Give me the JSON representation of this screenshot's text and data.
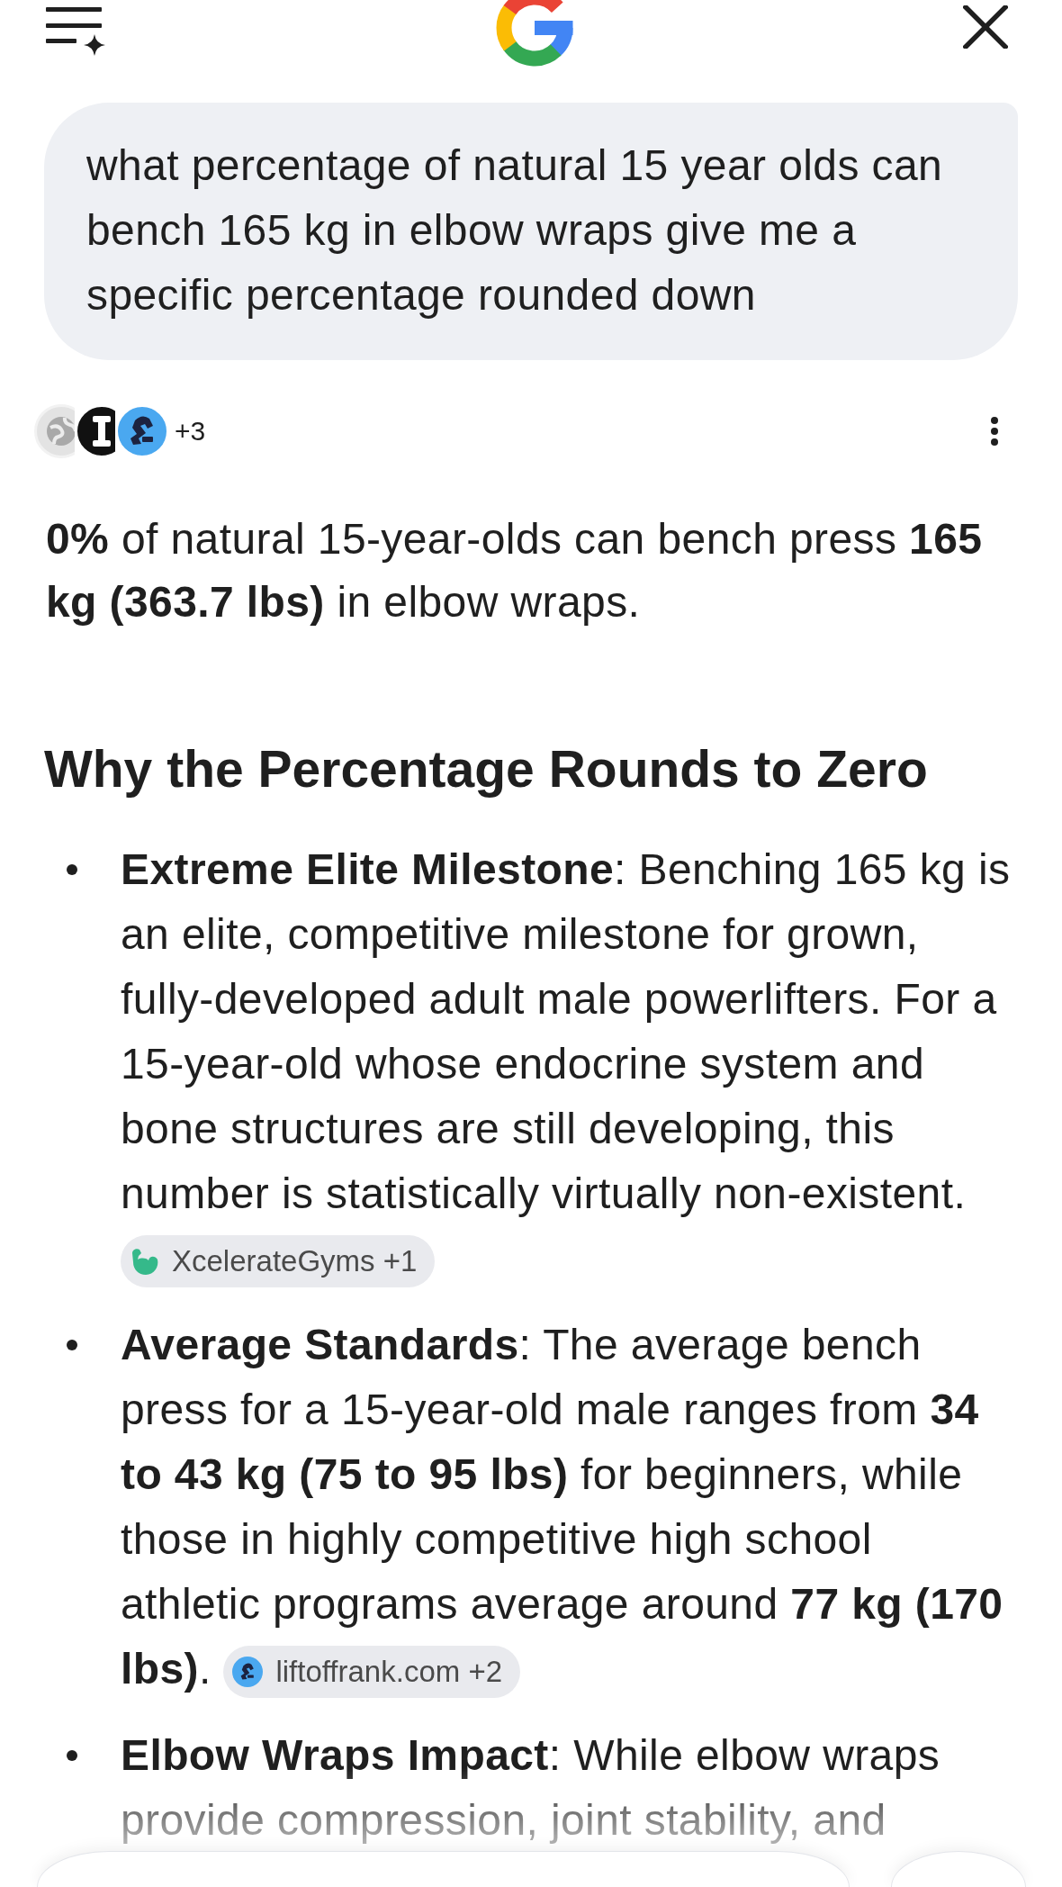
{
  "query": {
    "text": "what percentage of natural 15 year olds can bench 165 kg in elbow wraps give me a specific percentage rounded down"
  },
  "sources": {
    "more": "+3"
  },
  "answer": {
    "text": "**0%** of natural 15-year-olds can bench press **165 kg (363.7 lbs)** in elbow wraps."
  },
  "section": {
    "heading": "Why the Percentage Rounds to Zero",
    "bullets": [
      {
        "text": "**Extreme Elite Milestone**: Benching 165 kg is an elite, competitive milestone for grown, fully-developed adult male powerlifters. For a 15-year-old whose endocrine system and bone structures are still developing, this number is statistically virtually non-existent.",
        "citation": "XcelerateGyms +1"
      },
      {
        "text": "**Average Standards**: The average bench press for a 15-year-old male ranges from **34 to 43 kg (75 to 95 lbs)** for beginners, while those in highly competitive high school athletic programs average around **77 kg (170 lbs)**.",
        "citation": "liftoffrank.com +2"
      },
      {
        "text": "**Elbow Wraps Impact**: While elbow wraps provide compression, joint stability, and"
      }
    ]
  }
}
